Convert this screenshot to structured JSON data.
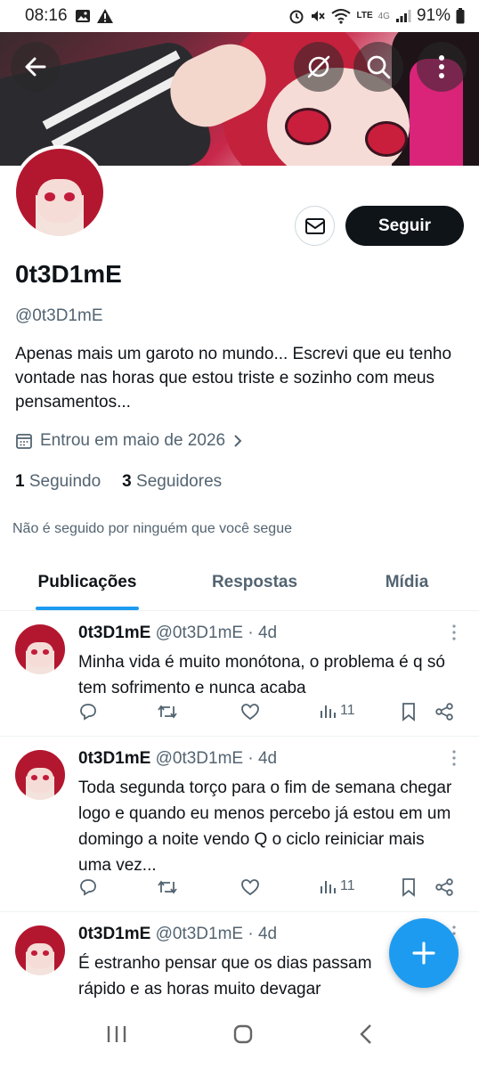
{
  "status_bar": {
    "time": "08:16",
    "battery": "91%",
    "network_label": "LTE",
    "signal_label": "4G"
  },
  "header": {
    "back_icon": "arrow-left-icon",
    "explore_icon": "explore-icon",
    "search_icon": "search-icon",
    "more_icon": "more-vertical-icon"
  },
  "profile": {
    "display_name": "0t3D1mE",
    "handle": "@0t3D1mE",
    "bio": "Apenas mais um garoto no mundo... Escrevi que eu tenho vontade nas horas que estou triste e sozinho com meus pensamentos...",
    "joined": "Entrou em maio de 2026",
    "following_count": "1",
    "following_label": "Seguindo",
    "followers_count": "3",
    "followers_label": "Seguidores",
    "not_followed_text": "Não é seguido por ninguém que você segue",
    "follow_button": "Seguir"
  },
  "tabs": [
    {
      "label": "Publicações",
      "active": true
    },
    {
      "label": "Respostas",
      "active": false
    },
    {
      "label": "Mídia",
      "active": false
    }
  ],
  "posts": [
    {
      "name": "0t3D1mE",
      "meta": "@0t3D1mE · 4d",
      "text": "Minha vida é muito monótona, o problema é q só tem sofrimento e nunca acaba",
      "views": "11"
    },
    {
      "name": "0t3D1mE",
      "meta": "@0t3D1mE · 4d",
      "text": "Toda segunda torço para o fim de semana chegar logo e quando eu menos percebo já estou em um domingo a noite vendo Q o ciclo reiniciar mais uma vez...",
      "views": "11"
    },
    {
      "name": "0t3D1mE",
      "meta": "@0t3D1mE · 4d",
      "text": "É estranho pensar que os dias passam rápido e as horas muito devagar",
      "views": ""
    }
  ],
  "colors": {
    "accent": "#1d9bf0",
    "text": "#0f1419",
    "muted": "#536471",
    "button_dark": "#0f1419"
  }
}
